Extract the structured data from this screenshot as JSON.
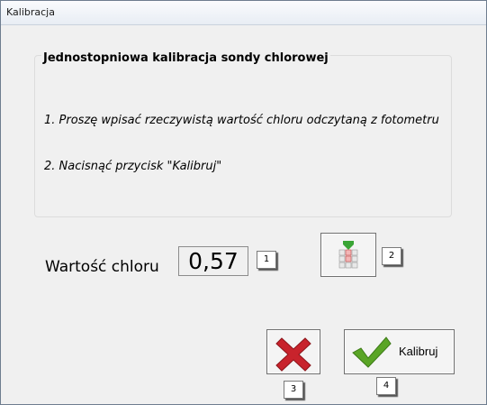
{
  "window": {
    "title": "Kalibracja"
  },
  "group": {
    "title": "Jednostopniowa kalibracja sondy chlorowej",
    "steps": [
      "1. Proszę wpisać rzeczywistą wartość chloru odczytaną z fotometru",
      "2. Nacisnąć przycisk \"Kalibruj\""
    ]
  },
  "value": {
    "label": "Wartość chloru",
    "value": "0,57"
  },
  "buttons": {
    "keypad_icon": "keypad-calculator-icon",
    "cancel_icon": "red-x-icon",
    "kalibruj_icon": "green-check-icon",
    "kalibruj_label": "Kalibruj"
  },
  "badges": [
    "1",
    "2",
    "3",
    "4"
  ],
  "colors": {
    "cancel": "#c8232c",
    "confirm": "#5aa526"
  }
}
